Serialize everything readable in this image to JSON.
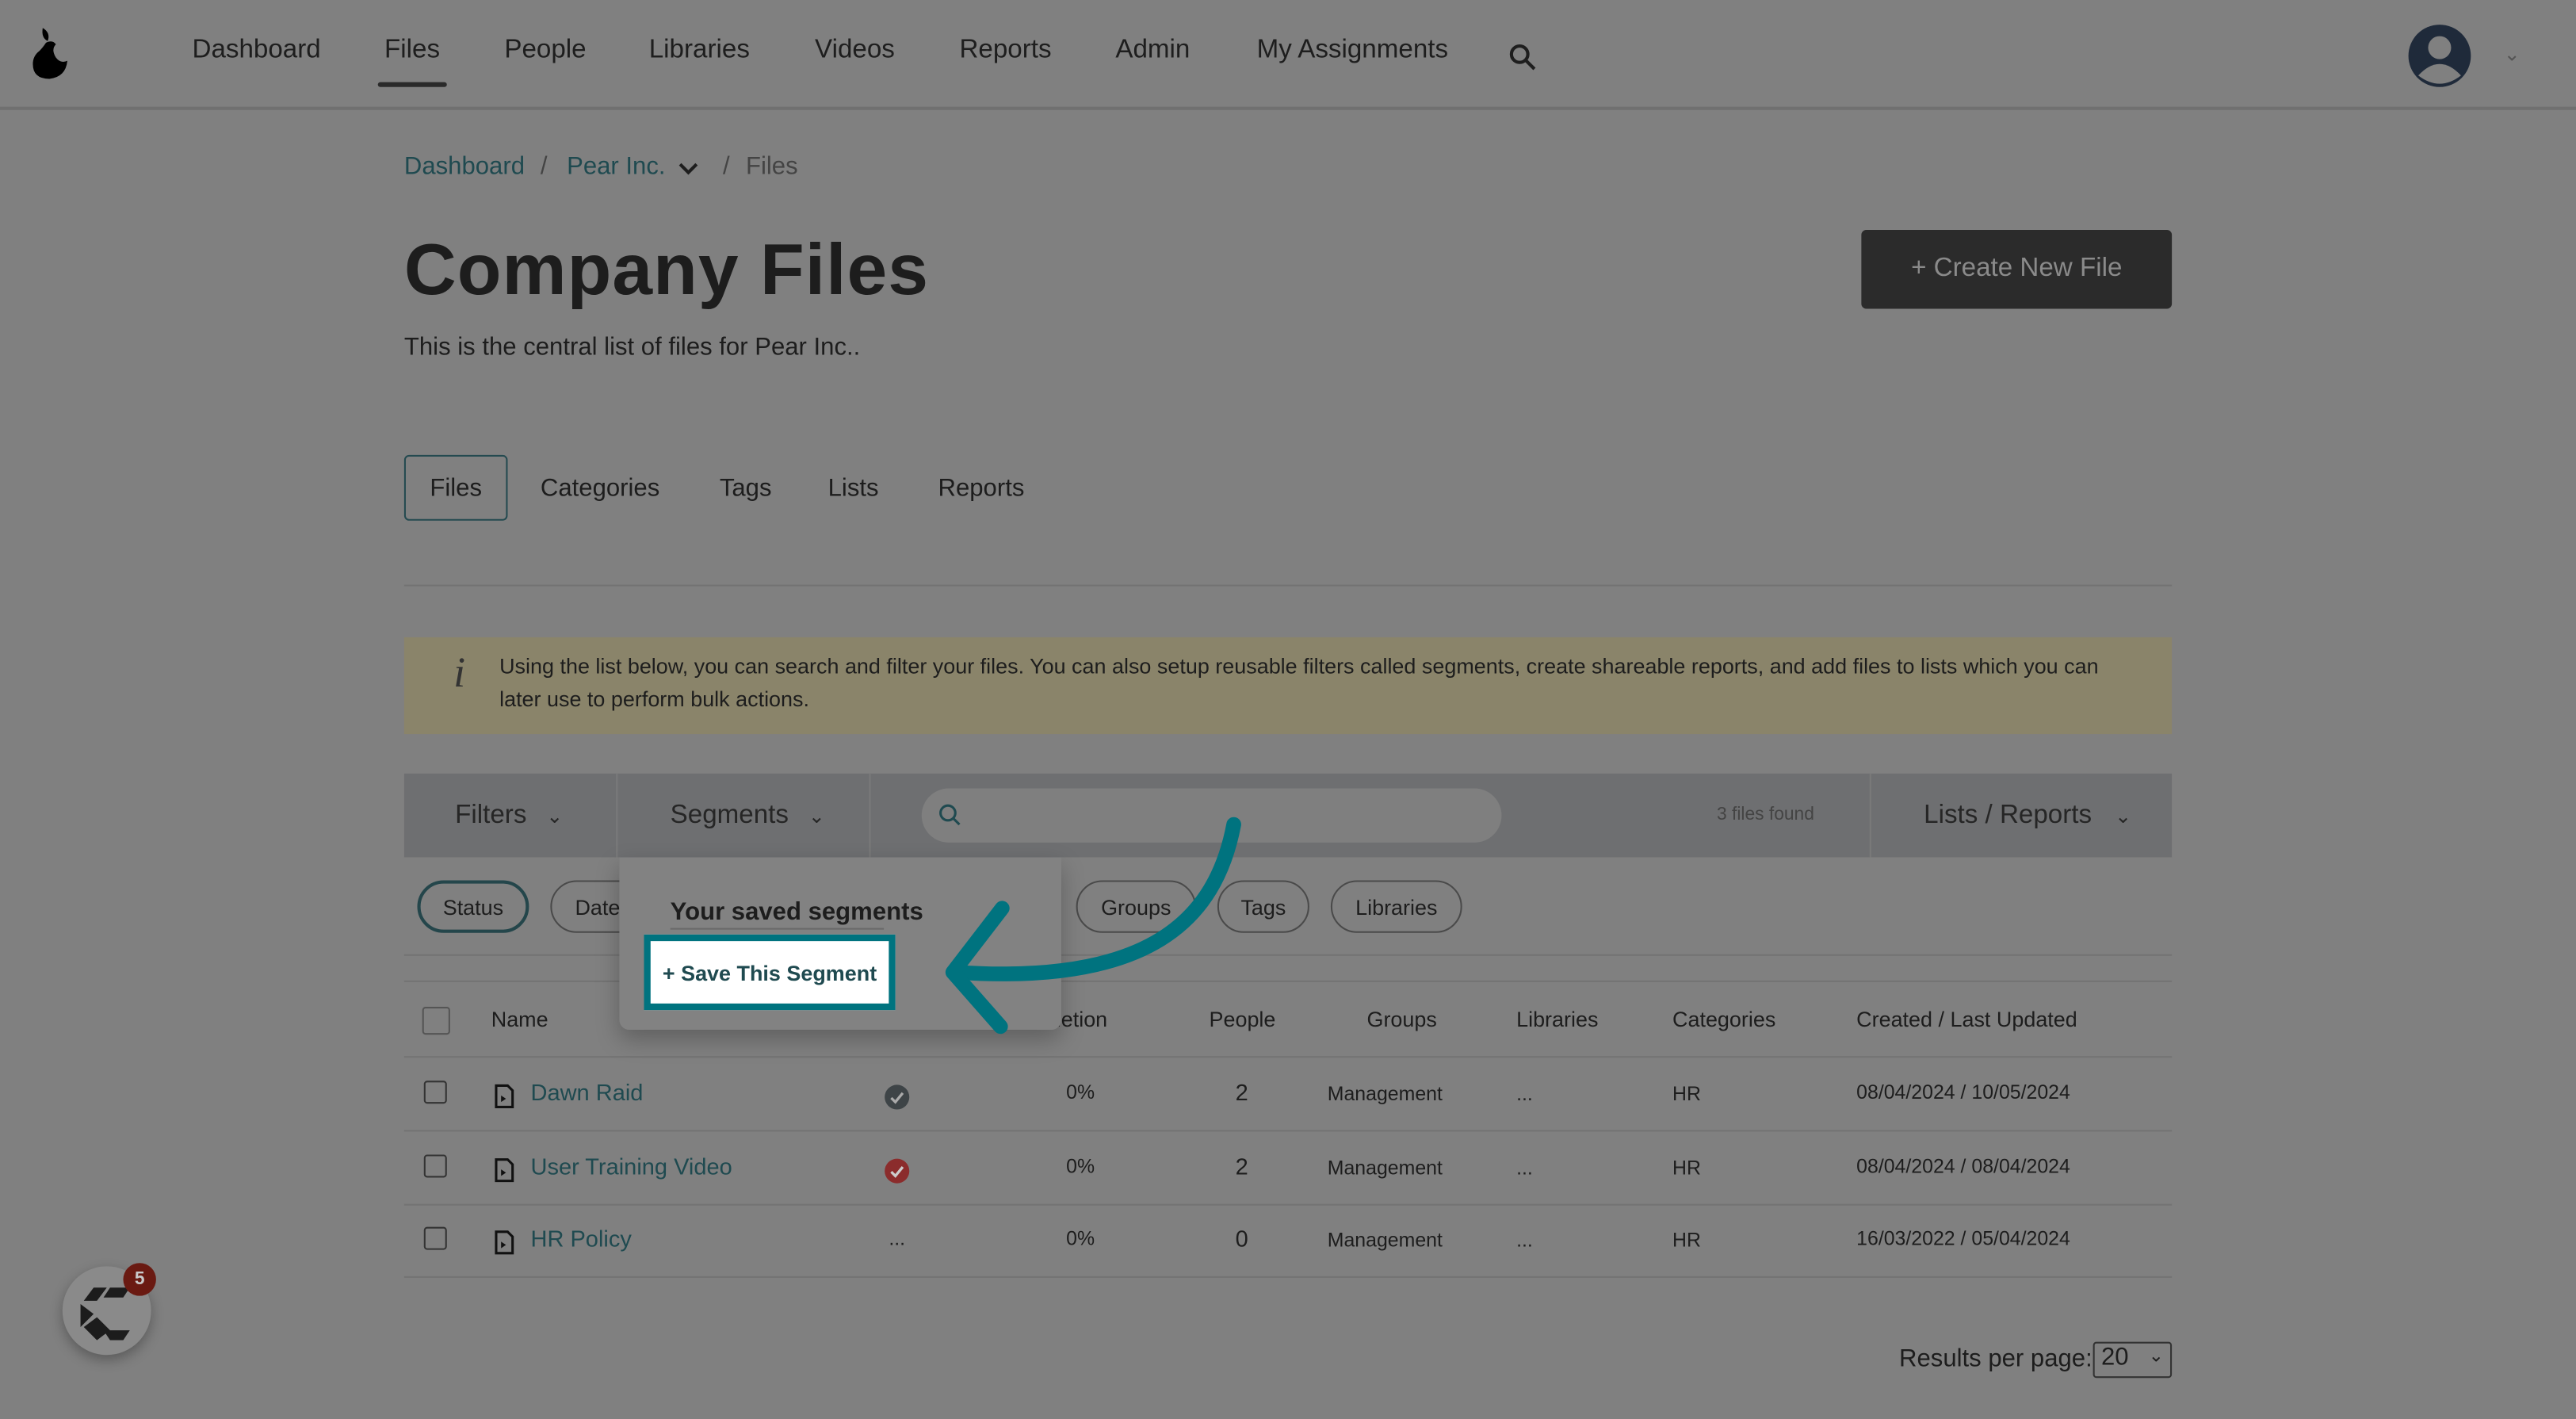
{
  "nav": {
    "items": [
      "Dashboard",
      "Files",
      "People",
      "Libraries",
      "Videos",
      "Reports",
      "Admin",
      "My Assignments"
    ],
    "active": "Files"
  },
  "breadcrumb": {
    "home": "Dashboard",
    "org": "Pear Inc.",
    "current": "Files",
    "sep": "/"
  },
  "page": {
    "title": "Company Files",
    "subtitle": "This is the central list of files for Pear Inc..",
    "create_label": "+ Create New File"
  },
  "tabs": [
    "Files",
    "Categories",
    "Tags",
    "Lists",
    "Reports"
  ],
  "info": {
    "text": "Using the list below, you can search and filter your files. You can also setup reusable filters called segments, create shareable reports, and add files to lists which you can later use to perform bulk actions."
  },
  "toolbar": {
    "filters": "Filters",
    "segments": "Segments",
    "search_placeholder": "",
    "count": "3 files found",
    "lists_reports": "Lists / Reports"
  },
  "chips": [
    "Status",
    "Date",
    "Groups",
    "Tags",
    "Libraries"
  ],
  "dropdown": {
    "heading": "Your saved segments",
    "save_label": "+ Save This Segment"
  },
  "table": {
    "headers": [
      "Name",
      "letion",
      "People",
      "Groups",
      "Libraries",
      "Categories",
      "Created / Last Updated"
    ],
    "rows": [
      {
        "name": "Dawn Raid",
        "status": "complete-dark",
        "completion": "0%",
        "people": "2",
        "groups": "Management",
        "libraries": "...",
        "categories": "HR",
        "dates": "08/04/2024 / 10/05/2024"
      },
      {
        "name": "User Training Video",
        "status": "complete-red",
        "completion": "0%",
        "people": "2",
        "groups": "Management",
        "libraries": "...",
        "categories": "HR",
        "dates": "08/04/2024 / 08/04/2024"
      },
      {
        "name": "HR Policy",
        "status": "...",
        "completion": "0%",
        "people": "0",
        "groups": "Management",
        "libraries": "...",
        "categories": "HR",
        "dates": "16/03/2022 / 05/04/2024"
      }
    ]
  },
  "pagination": {
    "label": "Results per page:",
    "value": "20"
  },
  "chat": {
    "badge": "5"
  },
  "colors": {
    "accent": "#00737f",
    "overlay_bg": "#808080",
    "status_red": "#8b2c2c"
  }
}
